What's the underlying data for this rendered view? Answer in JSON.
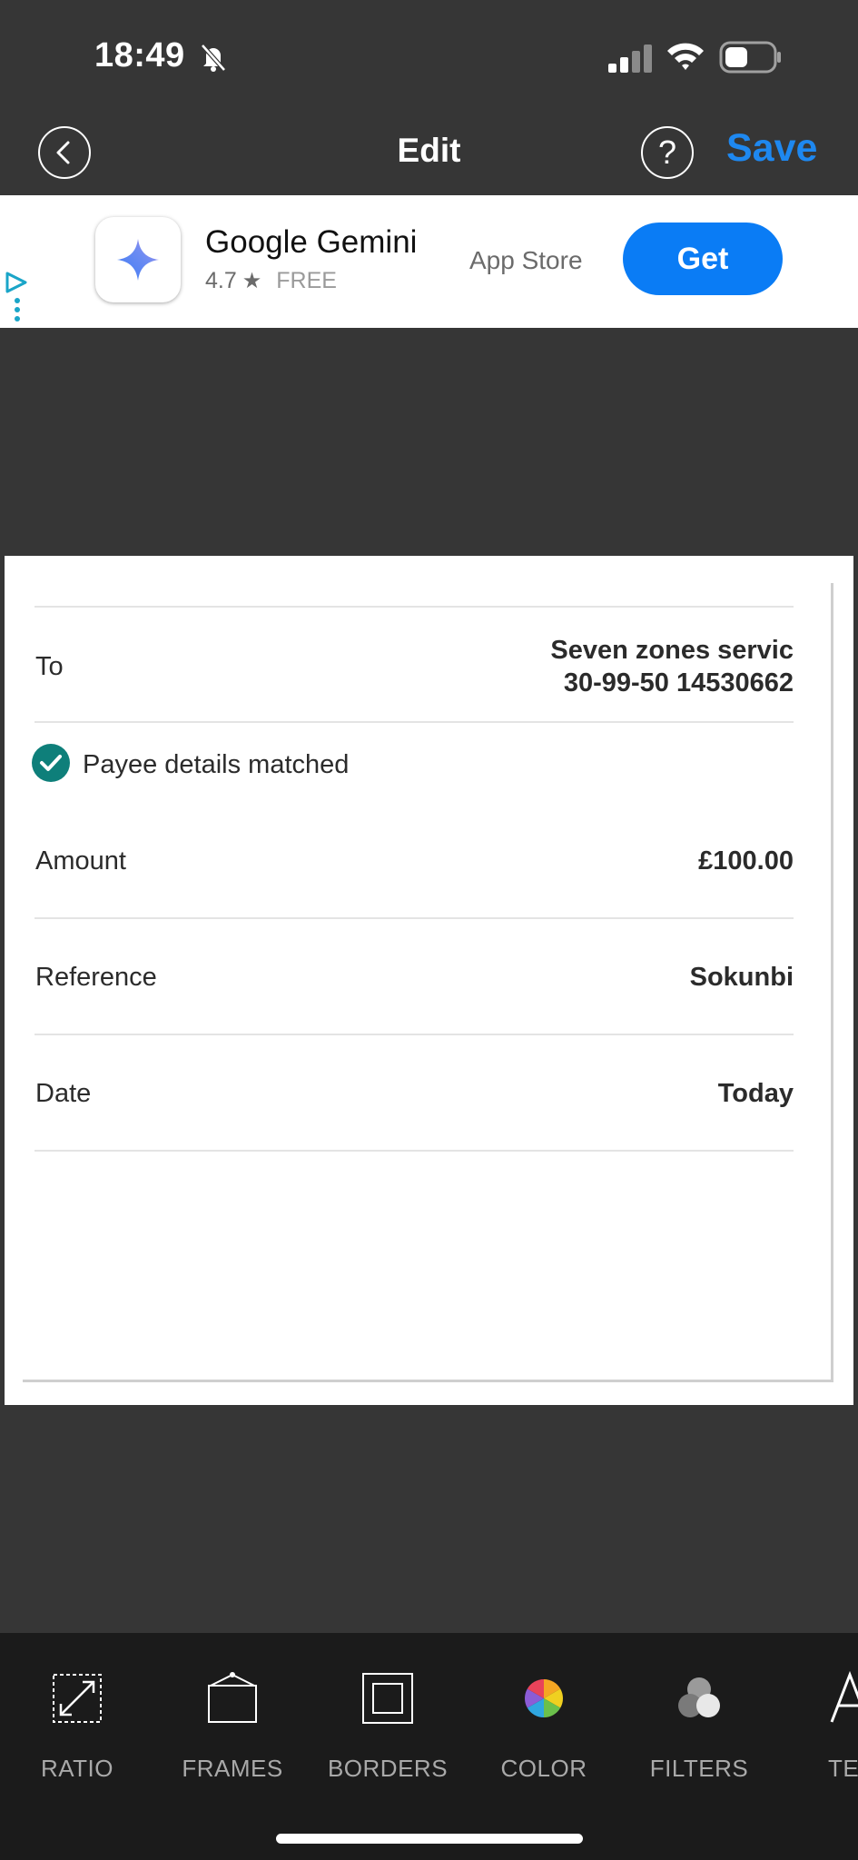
{
  "status_bar": {
    "time": "18:49"
  },
  "nav": {
    "title": "Edit",
    "help_label": "?",
    "save_label": "Save"
  },
  "ad": {
    "app_name": "Google Gemini",
    "rating": "4.7",
    "price": "FREE",
    "store": "App Store",
    "cta": "Get"
  },
  "document": {
    "to_label": "To",
    "to_name": "Seven zones servic",
    "to_account": "30-99-50 14530662",
    "match_text": "Payee details matched",
    "rows": [
      {
        "label": "Amount",
        "value": "£100.00"
      },
      {
        "label": "Reference",
        "value": "Sokunbi"
      },
      {
        "label": "Date",
        "value": "Today"
      }
    ]
  },
  "toolbar": {
    "items": [
      {
        "label": "RATIO",
        "icon": "ratio-icon"
      },
      {
        "label": "FRAMES",
        "icon": "frames-icon"
      },
      {
        "label": "BORDERS",
        "icon": "borders-icon"
      },
      {
        "label": "COLOR",
        "icon": "color-wheel-icon"
      },
      {
        "label": "FILTERS",
        "icon": "filters-icon"
      },
      {
        "label": "TEX",
        "icon": "text-icon"
      }
    ]
  },
  "colors": {
    "accent": "#1e88f0",
    "get_button": "#0a7cf5",
    "check": "#0e7f7a"
  }
}
